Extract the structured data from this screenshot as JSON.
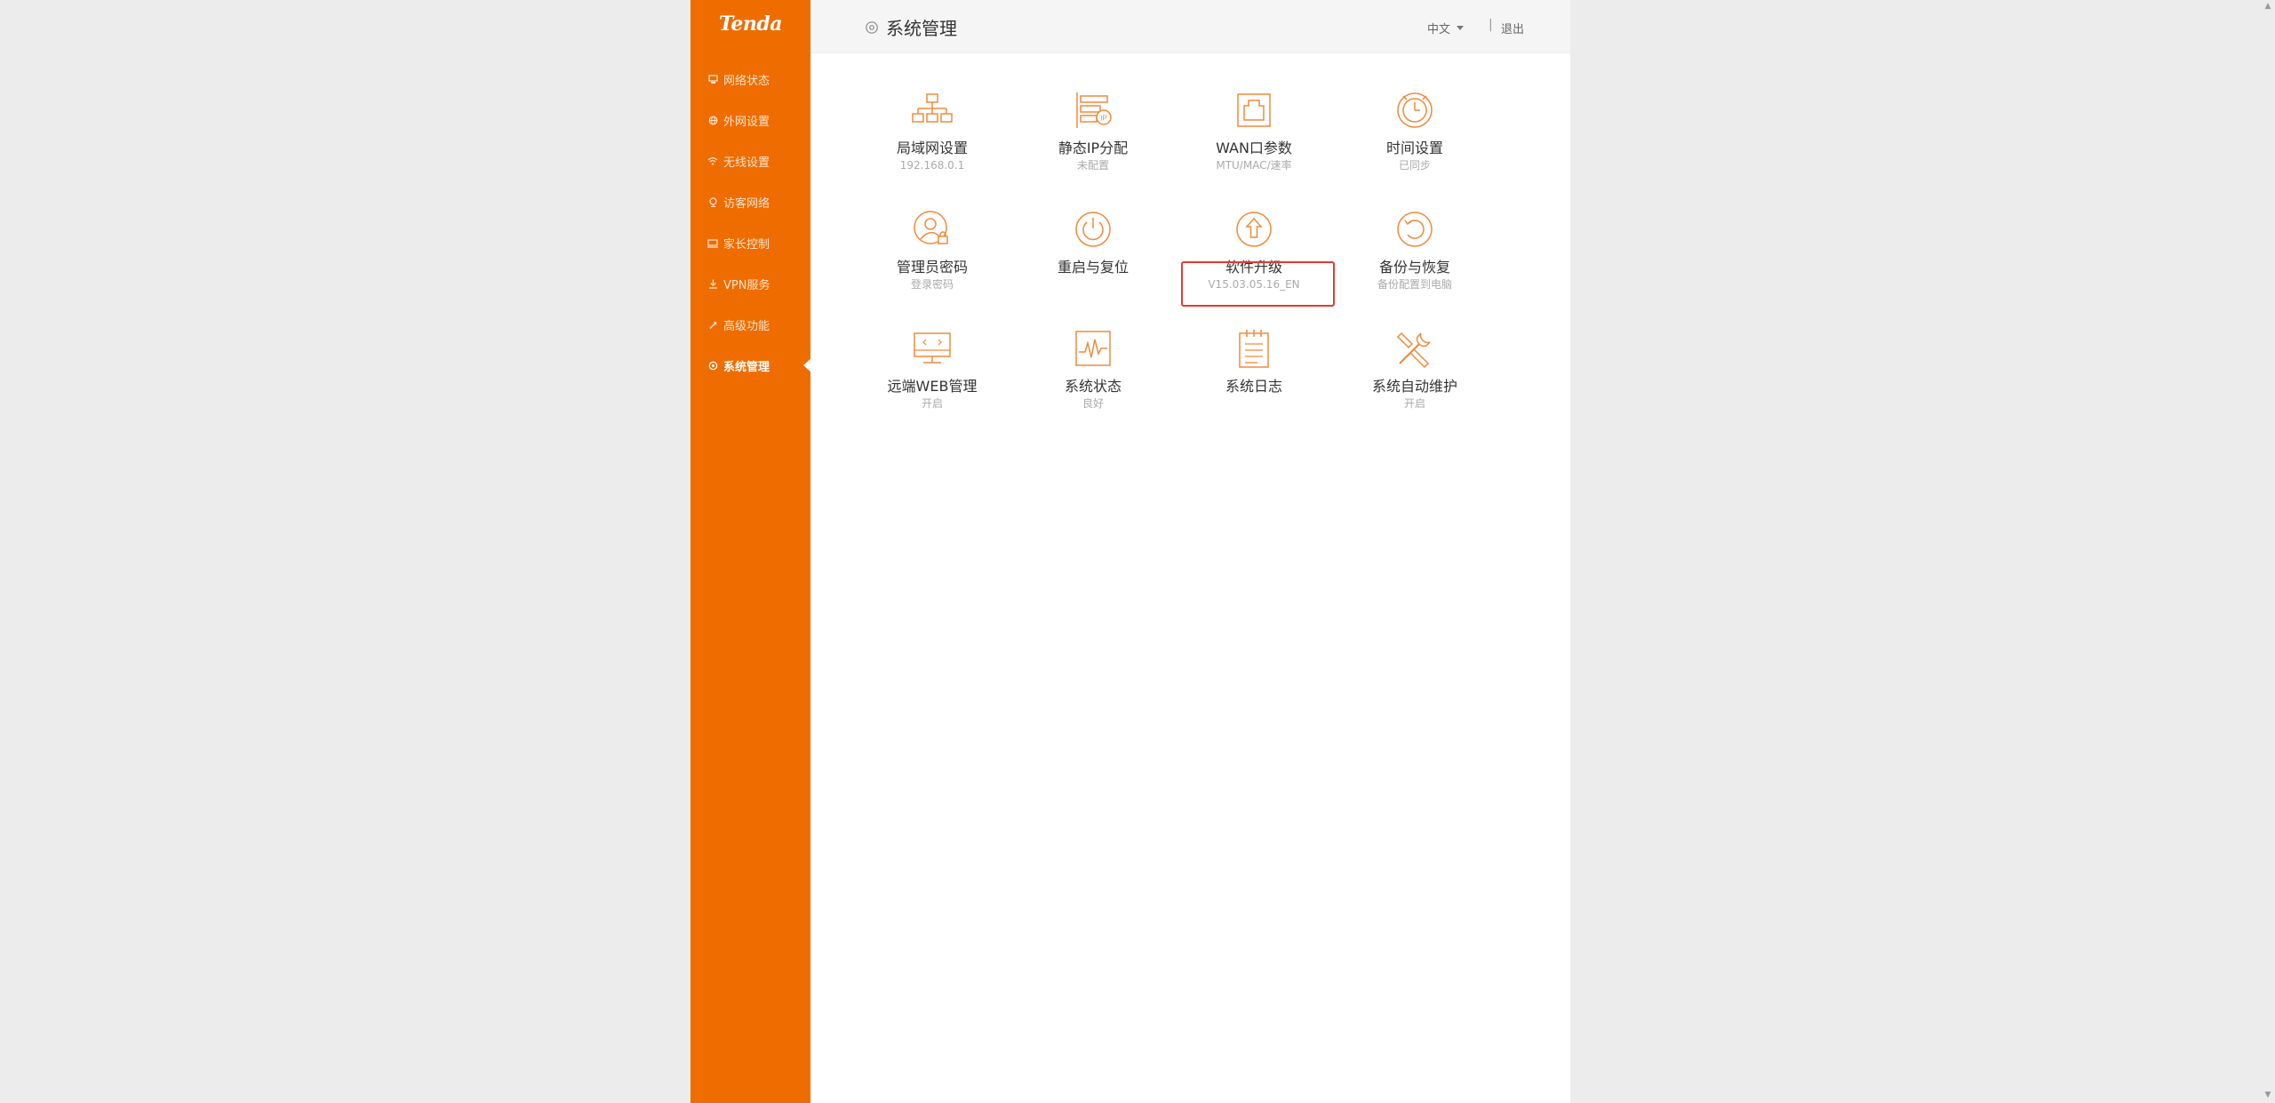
{
  "brand": {
    "logo_text": "Tenda",
    "accent_color": "#ef6c00"
  },
  "sidebar": {
    "items": [
      {
        "label": "网络状态",
        "icon": "network-status-icon"
      },
      {
        "label": "外网设置",
        "icon": "globe-icon"
      },
      {
        "label": "无线设置",
        "icon": "wifi-icon"
      },
      {
        "label": "访客网络",
        "icon": "guest-icon"
      },
      {
        "label": "家长控制",
        "icon": "parental-control-icon"
      },
      {
        "label": "VPN服务",
        "icon": "vpn-icon"
      },
      {
        "label": "高级功能",
        "icon": "wrench-icon"
      },
      {
        "label": "系统管理",
        "icon": "gear-icon",
        "active": true
      }
    ]
  },
  "header": {
    "title": "系统管理",
    "title_icon": "gear-icon",
    "language": "中文",
    "separator": "|",
    "logout": "退出"
  },
  "tiles": [
    {
      "label": "局域网设置",
      "sub": "192.168.0.1",
      "icon": "lan-topology-icon"
    },
    {
      "label": "静态IP分配",
      "sub": "未配置",
      "icon": "static-ip-icon"
    },
    {
      "label": "WAN口参数",
      "sub": "MTU/MAC/速率",
      "icon": "wan-port-icon"
    },
    {
      "label": "时间设置",
      "sub": "已同步",
      "icon": "clock-icon"
    },
    {
      "label": "管理员密码",
      "sub": "登录密码",
      "icon": "admin-lock-icon"
    },
    {
      "label": "重启与复位",
      "sub": "",
      "icon": "power-icon"
    },
    {
      "label": "软件升级",
      "sub": "V15.03.05.16_EN",
      "icon": "upgrade-arrow-icon"
    },
    {
      "label": "备份与恢复",
      "sub": "备份配置到电脑",
      "icon": "backup-restore-icon"
    },
    {
      "label": "远端WEB管理",
      "sub": "开启",
      "icon": "remote-web-icon"
    },
    {
      "label": "系统状态",
      "sub": "良好",
      "icon": "system-status-icon"
    },
    {
      "label": "系统日志",
      "sub": "",
      "icon": "system-log-icon"
    },
    {
      "label": "系统自动维护",
      "sub": "开启",
      "icon": "auto-maintenance-icon"
    }
  ]
}
